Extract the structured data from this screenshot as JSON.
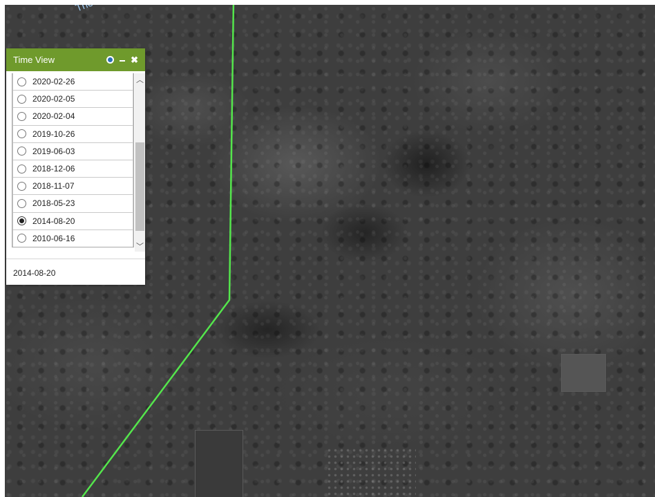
{
  "map": {
    "street_label": "Thom"
  },
  "time_view": {
    "title": "Time View",
    "icons": {
      "help": "help-icon",
      "minimize": "minimize-icon",
      "close": "close-icon"
    },
    "dates": [
      {
        "label": "2020-02-26",
        "selected": false
      },
      {
        "label": "2020-02-05",
        "selected": false
      },
      {
        "label": "2020-02-04",
        "selected": false
      },
      {
        "label": "2019-10-26",
        "selected": false
      },
      {
        "label": "2019-06-03",
        "selected": false
      },
      {
        "label": "2018-12-06",
        "selected": false
      },
      {
        "label": "2018-11-07",
        "selected": false
      },
      {
        "label": "2018-05-23",
        "selected": false
      },
      {
        "label": "2014-08-20",
        "selected": true
      },
      {
        "label": "2010-06-16",
        "selected": false
      }
    ],
    "selected_value": "2014-08-20"
  },
  "colors": {
    "header_green": "#6f9a2c",
    "boundary_line": "#54e64c",
    "street_label": "#9cc8f0"
  }
}
